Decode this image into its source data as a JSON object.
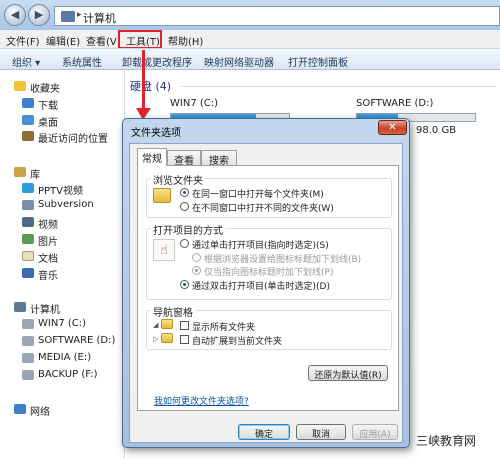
{
  "explorer": {
    "address": {
      "crumb": "计算机",
      "separator": "▸"
    },
    "nav": {
      "back": "◀",
      "forward": "▶"
    },
    "menu": [
      "文件(F)",
      "编辑(E)",
      "查看(V)",
      "工具(T)",
      "帮助(H)"
    ],
    "toolbar": [
      "组织 ▾",
      "系统属性",
      "卸载或更改程序",
      "映射网络驱动器",
      "打开控制面板"
    ],
    "sidebar": {
      "favorites": [
        "收藏夹",
        "下载",
        "桌面",
        "最近访问的位置"
      ],
      "libraries": [
        "库",
        "PPTV视频",
        "Subversion",
        "视频",
        "图片",
        "文档",
        "音乐"
      ],
      "computer": [
        "计算机",
        "WIN7 (C:)",
        "SOFTWARE (D:)",
        "MEDIA (E:)",
        "BACKUP (F:)"
      ],
      "network": "网络"
    },
    "content": {
      "group_header": "硬盘 (4)",
      "drives": [
        {
          "label": "WIN7 (C:)",
          "fill": 0.72,
          "detail": ""
        },
        {
          "label": "SOFTWARE (D:)",
          "fill": 0.35,
          "detail": "98.0 GB"
        }
      ]
    }
  },
  "dialog": {
    "title": "文件夹选项",
    "close": "✕",
    "tabs": [
      "常规",
      "查看",
      "搜索"
    ],
    "browse": {
      "legend": "浏览文件夹",
      "options": [
        "在同一窗口中打开每个文件夹(M)",
        "在不同窗口中打开不同的文件夹(W)"
      ]
    },
    "open_items": {
      "legend": "打开项目的方式",
      "options": [
        "通过单击打开项目(指向时选定)(S)",
        "根据浏览器设置给图标标题加下划线(B)",
        "仅当指向图标标题时加下划线(P)",
        "通过双击打开项目(单击时选定)(D)"
      ]
    },
    "nav_pane": {
      "legend": "导航窗格",
      "options": [
        "显示所有文件夹",
        "自动扩展到当前文件夹"
      ]
    },
    "restore_button": "还原为默认值(R)",
    "help_link": "我如何更改文件夹选项?",
    "buttons": [
      "确定",
      "取消",
      "应用(A)"
    ]
  },
  "watermark": "三峡教育网",
  "colors": {
    "highlight": "#e0232a",
    "link": "#0b53a4",
    "dialog_frame": "#a7c0df"
  }
}
